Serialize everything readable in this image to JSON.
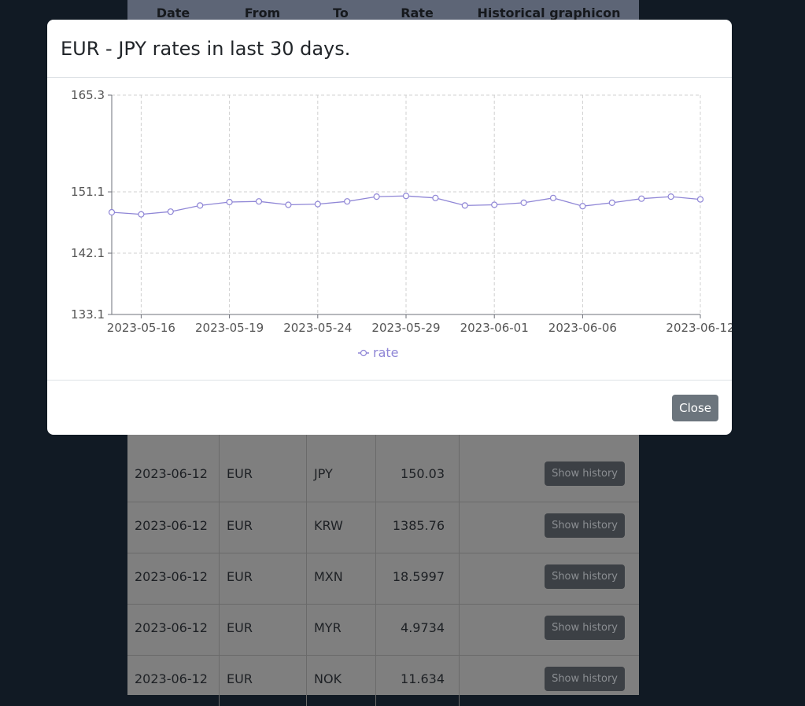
{
  "table": {
    "headers": {
      "date": "Date",
      "from": "From",
      "to": "To",
      "rate": "Rate",
      "historical": "Historical graphicon"
    },
    "rows": [
      {
        "date": "2023-06-12",
        "from": "EUR",
        "to": "JPY",
        "rate": "150.03",
        "action": "Show history"
      },
      {
        "date": "2023-06-12",
        "from": "EUR",
        "to": "KRW",
        "rate": "1385.76",
        "action": "Show history"
      },
      {
        "date": "2023-06-12",
        "from": "EUR",
        "to": "MXN",
        "rate": "18.5997",
        "action": "Show history"
      },
      {
        "date": "2023-06-12",
        "from": "EUR",
        "to": "MYR",
        "rate": "4.9734",
        "action": "Show history"
      },
      {
        "date": "2023-06-12",
        "from": "EUR",
        "to": "NOK",
        "rate": "11.634",
        "action": "Show history"
      }
    ]
  },
  "modal": {
    "title": "EUR - JPY rates in last 30 days.",
    "close_label": "Close"
  },
  "chart_data": {
    "type": "line",
    "ylim": [
      133.1,
      165.3
    ],
    "y_ticks": [
      "133.1",
      "142.1",
      "151.1",
      "165.3"
    ],
    "x_tick_labels": [
      "2023-05-16",
      "2023-05-19",
      "2023-05-24",
      "2023-05-29",
      "2023-06-01",
      "2023-06-06",
      "2023-06-12"
    ],
    "x_tick_indices": [
      1,
      4,
      7,
      10,
      13,
      16,
      20
    ],
    "legend": "rate",
    "legend_position": "bottom-center",
    "grid": true,
    "color": "#8f86d6",
    "series": [
      {
        "name": "rate",
        "values": [
          148.1,
          147.8,
          148.2,
          149.1,
          149.6,
          149.7,
          149.2,
          149.3,
          149.7,
          150.4,
          150.5,
          150.2,
          149.1,
          149.2,
          149.5,
          150.2,
          149.0,
          149.5,
          150.1,
          150.4,
          150.0
        ]
      }
    ]
  }
}
